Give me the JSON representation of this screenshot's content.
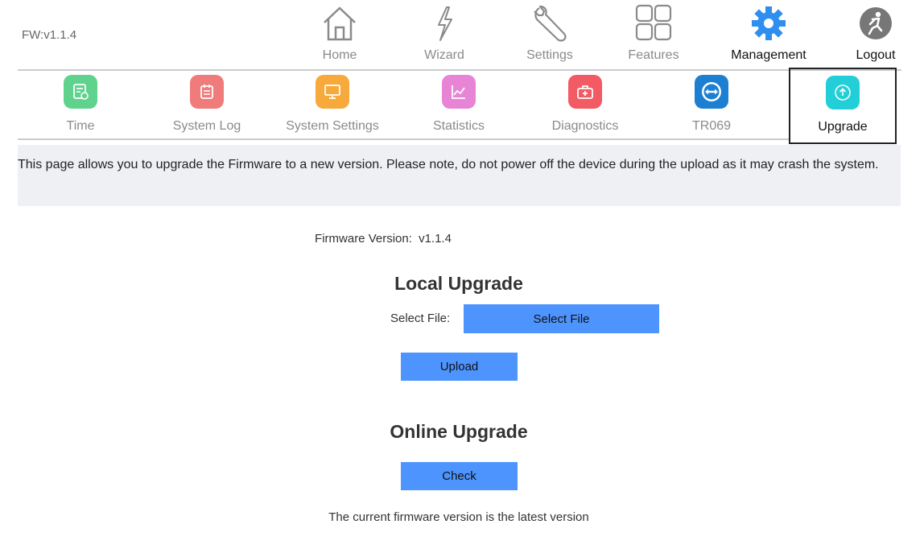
{
  "header": {
    "fw_version": "FW:v1.1.4"
  },
  "top_nav": {
    "items": [
      {
        "label": "Home",
        "icon": "home-icon"
      },
      {
        "label": "Wizard",
        "icon": "wizard-icon"
      },
      {
        "label": "Settings",
        "icon": "wrench-icon"
      },
      {
        "label": "Features",
        "icon": "grid-icon"
      },
      {
        "label": "Management",
        "icon": "gear-icon",
        "active": true
      },
      {
        "label": "Logout",
        "icon": "logout-icon"
      }
    ]
  },
  "sub_nav": {
    "items": [
      {
        "label": "Time",
        "icon": "time-icon",
        "color": "#5fd38d"
      },
      {
        "label": "System Log",
        "icon": "system-log-icon",
        "color": "#f07b7b"
      },
      {
        "label": "System Settings",
        "icon": "monitor-icon",
        "color": "#f7a93b"
      },
      {
        "label": "Statistics",
        "icon": "chart-icon",
        "color": "#e884d6"
      },
      {
        "label": "Diagnostics",
        "icon": "toolbox-icon",
        "color": "#f25a64"
      },
      {
        "label": "TR069",
        "icon": "tr069-icon",
        "color": "#1d7fd1"
      },
      {
        "label": "Upgrade",
        "icon": "upgrade-icon",
        "color": "#22cfd8",
        "active": true
      }
    ]
  },
  "info": {
    "text": "This page allows you to upgrade the Firmware to a new version. Please note, do not power off the device during the upload as it may crash the system."
  },
  "firmware": {
    "label": "Firmware Version:",
    "value": "v1.1.4"
  },
  "local_upgrade": {
    "title": "Local Upgrade",
    "select_label": "Select File:",
    "select_button": "Select File",
    "upload_button": "Upload"
  },
  "online_upgrade": {
    "title": "Online Upgrade",
    "check_button": "Check",
    "status": "The current firmware version is the latest version"
  },
  "colors": {
    "button_blue": "#4d94ff",
    "banner_bg": "#eef0f3",
    "management_gear": "#2f8ff0"
  }
}
